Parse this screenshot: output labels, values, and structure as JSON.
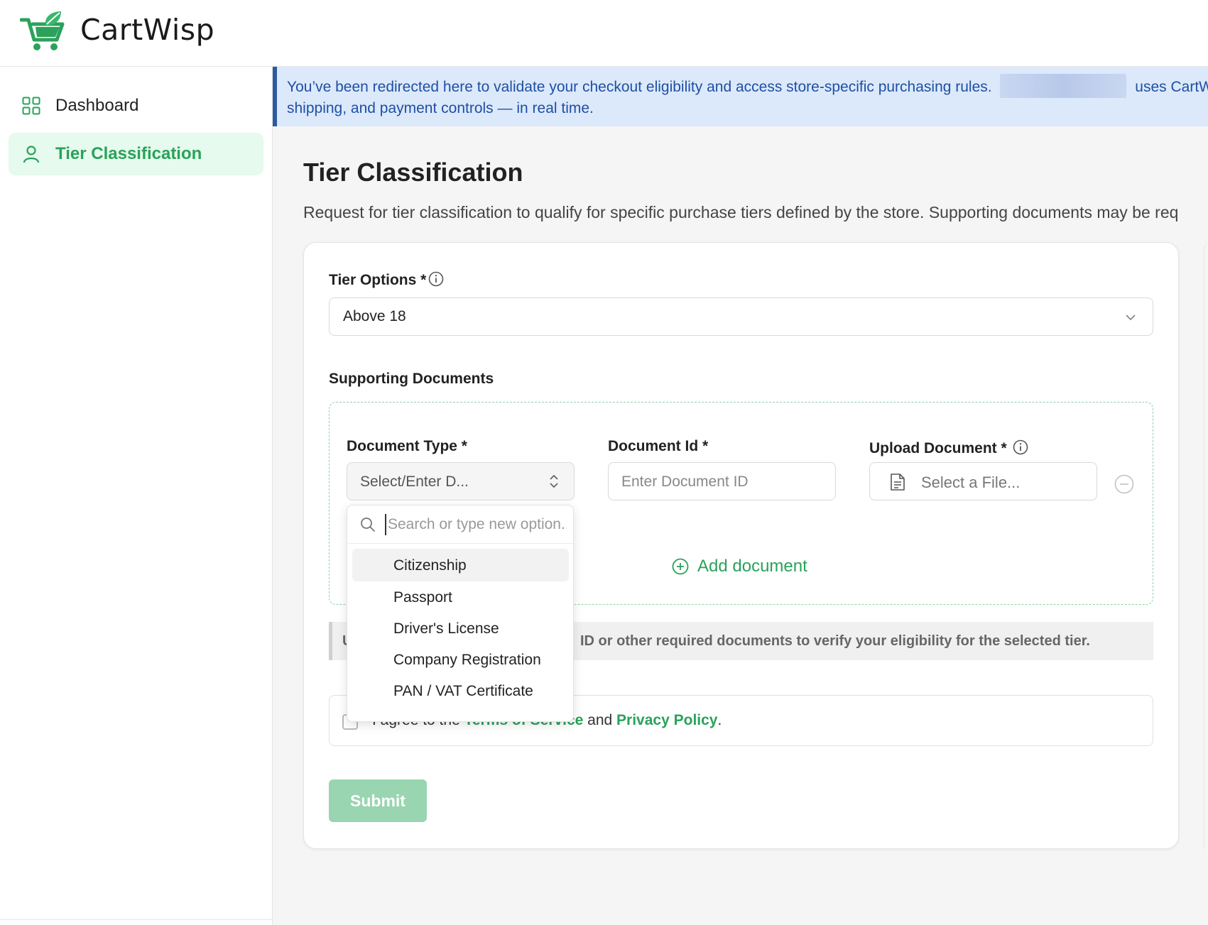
{
  "app": {
    "brand": "CartWisp",
    "accent": "#2aa25a"
  },
  "sidebar": {
    "items": [
      {
        "label": "Dashboard",
        "icon": "grid-icon",
        "active": false
      },
      {
        "label": "Tier Classification",
        "icon": "user-icon",
        "active": true
      }
    ]
  },
  "banner": {
    "text_before": "You’ve been redirected here to validate your checkout eligibility and access store-specific purchasing rules.",
    "text_after": "uses CartW",
    "line2": "shipping, and payment controls — in real time."
  },
  "page": {
    "title": "Tier Classification",
    "description": "Request for tier classification to qualify for specific purchase tiers defined by the store. Supporting documents may be req"
  },
  "form": {
    "tier_options_label": "Tier Options *",
    "tier_selected": "Above 18",
    "supporting_docs_label": "Supporting Documents",
    "document_type_label": "Document Type *",
    "document_type_placeholder": "Select/Enter D...",
    "document_id_label": "Document Id *",
    "document_id_placeholder": "Enter Document ID",
    "upload_label": "Upload Document *",
    "upload_placeholder": "Select a File...",
    "add_document": "Add document",
    "notice_prefix": "U",
    "notice_text": "ID or other required documents to verify your eligibility for the selected tier.",
    "agree_prefix": "I agree to the",
    "terms_link": "Terms of Service",
    "agree_and": "and",
    "privacy_link": "Privacy Policy",
    "agree_end": ".",
    "submit_label": "Submit"
  },
  "dropdown": {
    "search_placeholder": "Search or type new option...",
    "options": [
      {
        "label": "Citizenship",
        "highlighted": true
      },
      {
        "label": "Passport",
        "highlighted": false
      },
      {
        "label": "Driver's License",
        "highlighted": false
      },
      {
        "label": "Company Registration",
        "highlighted": false
      },
      {
        "label": "PAN / VAT Certificate",
        "highlighted": false
      }
    ]
  }
}
